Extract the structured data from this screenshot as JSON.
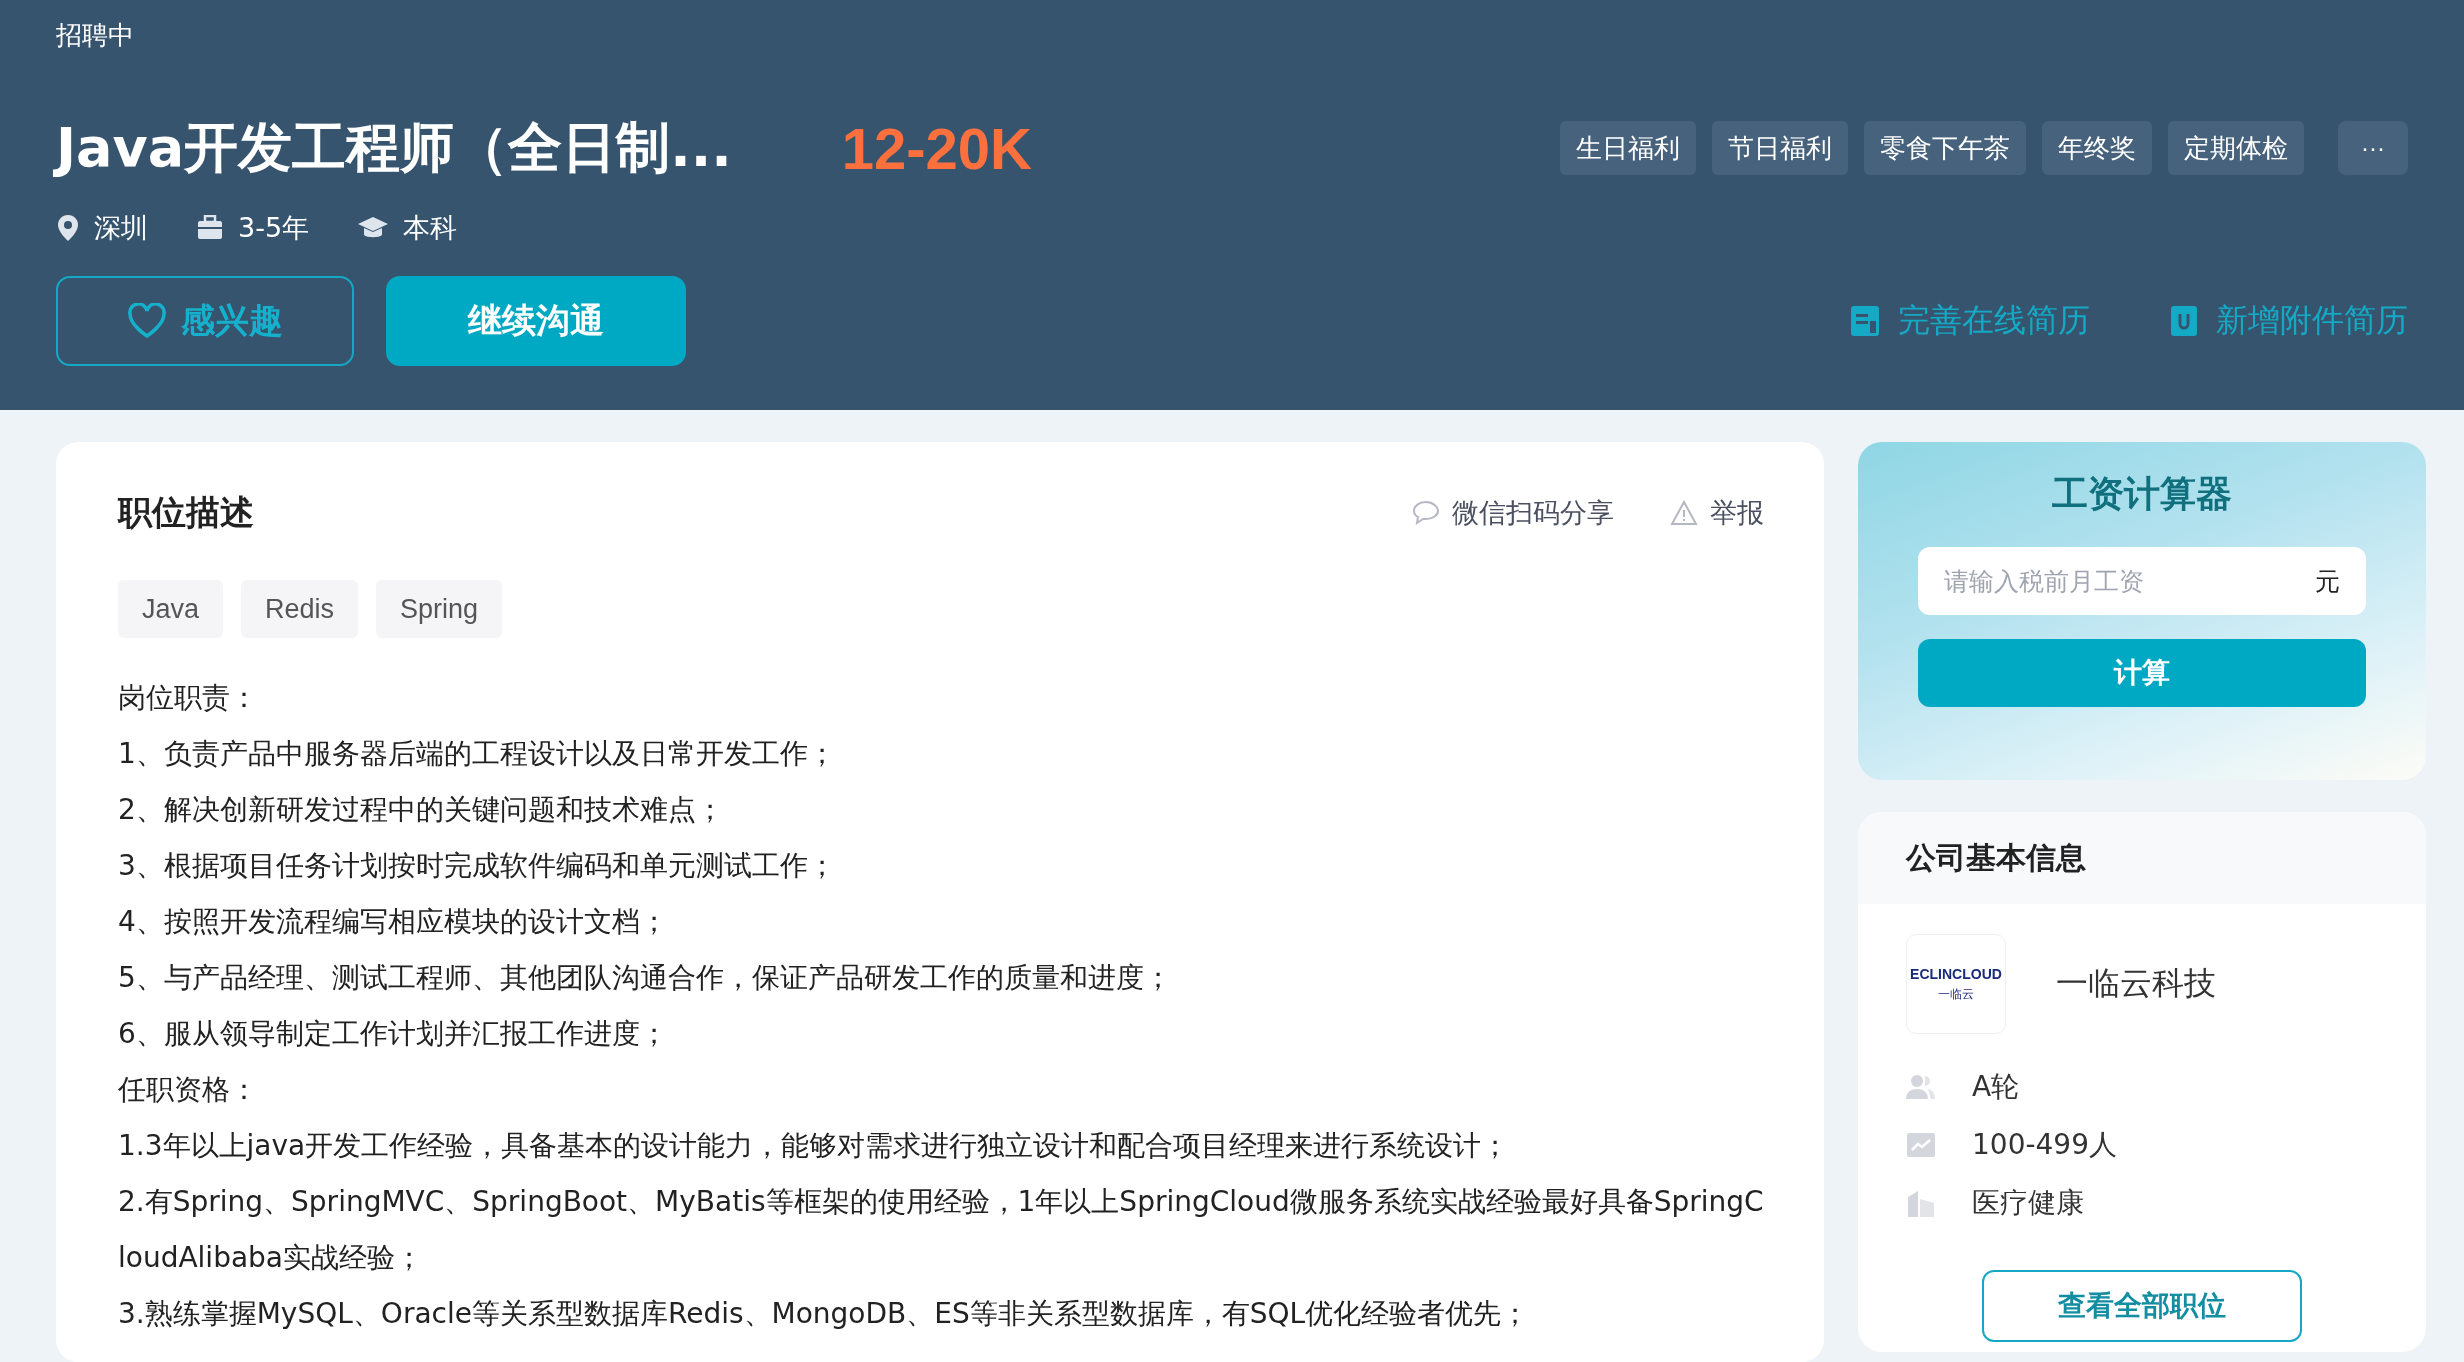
{
  "header": {
    "status": "招聘中",
    "title": "Java开发工程师（全日制...",
    "salary": "12-20K",
    "meta": [
      {
        "kind": "location",
        "text": "深圳"
      },
      {
        "kind": "experience",
        "text": "3-5年"
      },
      {
        "kind": "education",
        "text": "本科"
      }
    ],
    "benefits": [
      "生日福利",
      "节日福利",
      "零食下午茶",
      "年终奖",
      "定期体检"
    ],
    "more": "···",
    "interest_button": "感兴趣",
    "chat_button": "继续沟通",
    "links": [
      {
        "kind": "resume",
        "text": "完善在线简历"
      },
      {
        "kind": "attachment",
        "text": "新增附件简历"
      }
    ]
  },
  "description": {
    "title": "职位描述",
    "actions": [
      {
        "kind": "share",
        "text": "微信扫码分享"
      },
      {
        "kind": "report",
        "text": "举报"
      }
    ],
    "tags": [
      "Java",
      "Redis",
      "Spring"
    ],
    "lines": [
      "岗位职责：",
      "1、负责产品中服务器后端的工程设计以及日常开发工作；",
      "2、解决创新研发过程中的关键问题和技术难点；",
      "3、根据项目任务计划按时完成软件编码和单元测试工作；",
      "4、按照开发流程编写相应模块的设计文档；",
      "5、与产品经理、测试工程师、其他团队沟通合作，保证产品研发工作的质量和进度；",
      "6、服从领导制定工作计划并汇报工作进度；",
      "任职资格：",
      "1.3年以上java开发工作经验，具备基本的设计能力，能够对需求进行独立设计和配合项目经理来进行系统设计；",
      "2.有Spring、SpringMVC、SpringBoot、MyBatis等框架的使用经验，1年以上SpringCloud微服务系统实战经验最好具备SpringCloudAlibaba实战经验；",
      "3.熟练掌握MySQL、Oracle等关系型数据库Redis、MongoDB、ES等非关系型数据库，有SQL优化经验者优先；"
    ]
  },
  "calculator": {
    "title": "工资计算器",
    "placeholder": "请输入税前月工资",
    "unit": "元",
    "button": "计算"
  },
  "company": {
    "title": "公司基本信息",
    "logo_text": "ECLINCLOUD",
    "logo_subtext": "一临云",
    "name": "一临云科技",
    "facts": [
      {
        "kind": "funding",
        "text": "A轮"
      },
      {
        "kind": "size",
        "text": "100-499人"
      },
      {
        "kind": "industry",
        "text": "医疗健康"
      }
    ],
    "button": "查看全部职位"
  }
}
